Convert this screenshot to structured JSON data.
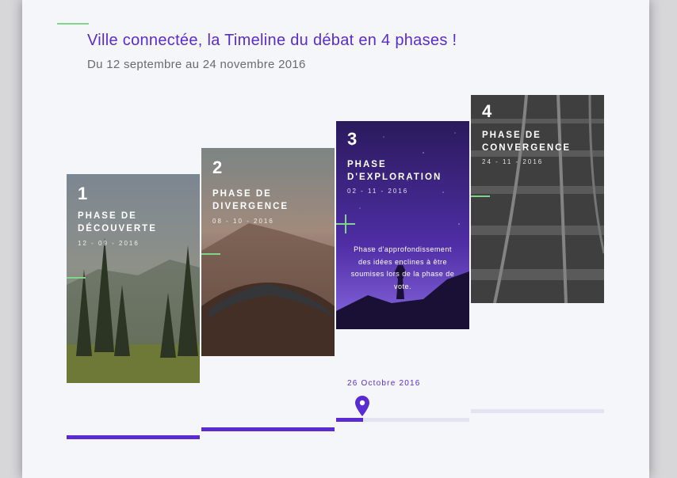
{
  "header": {
    "title": "Ville connectée, la Timeline du débat en 4 phases !",
    "subtitle": "Du 12 septembre au 24 novembre 2016"
  },
  "colors": {
    "accent": "#5a2bd0",
    "green": "#7fd68a",
    "track": "#e3e3f1"
  },
  "phases": [
    {
      "number": "1",
      "name": "Phase de découverte",
      "date": "12 - 09 - 2016",
      "image": "forest"
    },
    {
      "number": "2",
      "name": "Phase de divergence",
      "date": "08 - 10 - 2016",
      "image": "road"
    },
    {
      "number": "3",
      "name": "Phase d'exploration",
      "date": "02 - 11 - 2016",
      "image": "starry-sky",
      "description": "Phase d'approfondissement des idées enclines à être soumises lors de la phase de vote."
    },
    {
      "number": "4",
      "name": "Phase de convergence",
      "date": "24 - 11 - 2016",
      "image": "railway"
    }
  ],
  "timeline": {
    "current_date": "26 Octobre 2016",
    "current_phase_progress": 0.2
  }
}
